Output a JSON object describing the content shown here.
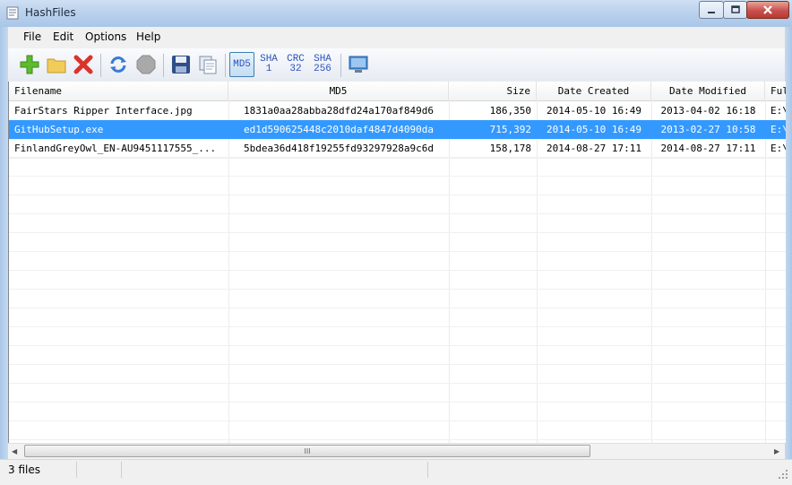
{
  "window": {
    "title": "HashFiles"
  },
  "menu": [
    "File",
    "Edit",
    "Options",
    "Help"
  ],
  "toolbar": {
    "icons": [
      "add-icon",
      "open-folder-icon",
      "delete-icon",
      "refresh-icon",
      "stop-icon",
      "save-icon",
      "copy-icon",
      "monitor-icon"
    ],
    "hash_buttons": [
      {
        "label": "MD5",
        "active": true
      },
      {
        "label": "SHA\n1",
        "active": false
      },
      {
        "label": "CRC\n32",
        "active": false
      },
      {
        "label": "SHA\n256",
        "active": false
      }
    ]
  },
  "columns": [
    "Filename",
    "MD5",
    "Size",
    "Date Created",
    "Date Modified",
    "Ful"
  ],
  "rows": [
    {
      "filename": "FairStars Ripper Interface.jpg",
      "md5": "1831a0aa28abba28dfd24a170af849d6",
      "size": "186,350",
      "created": "2014-05-10 16:49",
      "modified": "2013-04-02 16:18",
      "full": "E:\\"
    },
    {
      "filename": "GitHubSetup.exe",
      "md5": "ed1d590625448c2010daf4847d4090da",
      "size": "715,392",
      "created": "2014-05-10 16:49",
      "modified": "2013-02-27 10:58",
      "full": "E:\\",
      "selected": true
    },
    {
      "filename": "FinlandGreyOwl_EN-AU9451117555_...",
      "md5": "5bdea36d418f19255fd93297928a9c6d",
      "size": "158,178",
      "created": "2014-08-27 17:11",
      "modified": "2014-08-27 17:11",
      "full": "E:\\"
    }
  ],
  "scrollbar": {
    "thumb_grip": "III"
  },
  "status": {
    "text": "3 files"
  },
  "colors": {
    "selection": "#3399ff",
    "title_bar": "#b9d1ec"
  }
}
